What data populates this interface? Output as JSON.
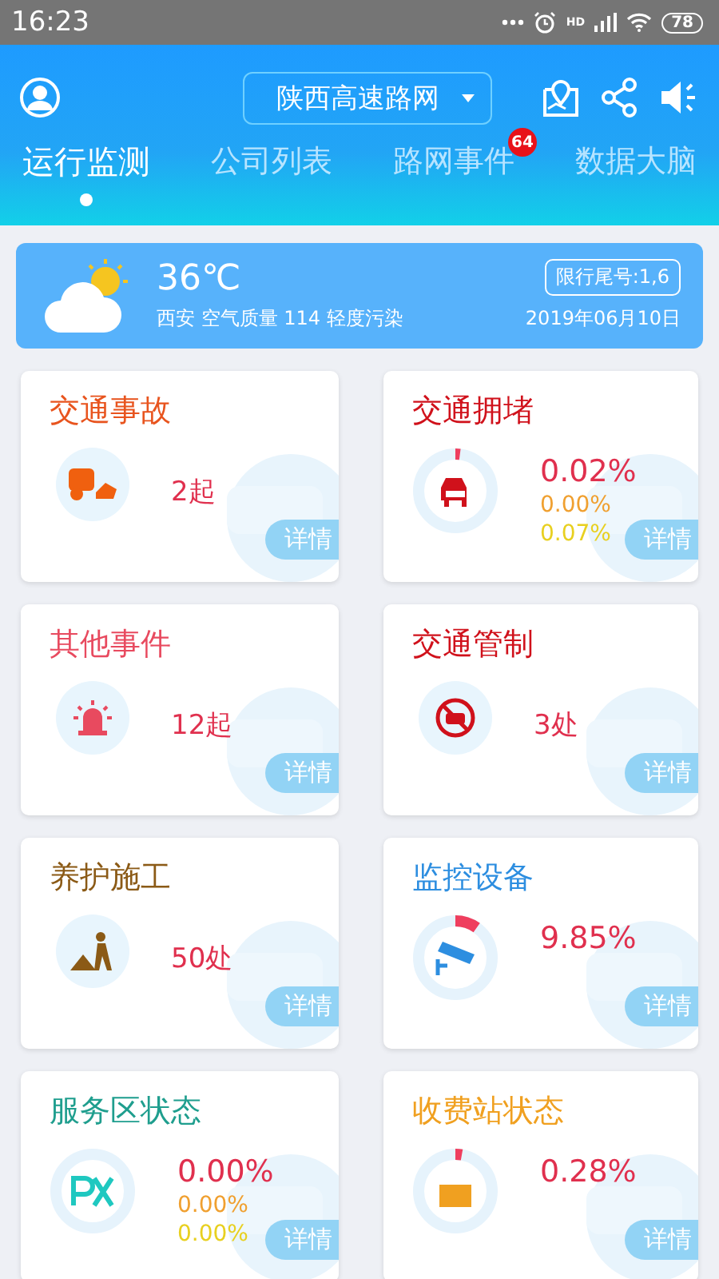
{
  "status_bar": {
    "time": "16:23",
    "network_label": "HD",
    "battery": "78"
  },
  "header": {
    "network_selector": "陕西高速路网"
  },
  "tabs": [
    {
      "label": "运行监测",
      "selected": true
    },
    {
      "label": "公司列表",
      "selected": false
    },
    {
      "label": "路网事件",
      "selected": false,
      "badge": "64"
    },
    {
      "label": "数据大脑",
      "selected": false
    }
  ],
  "weather": {
    "temperature": "36℃",
    "summary": "西安 空气质量 114 轻度污染",
    "restriction": "限行尾号:1,6",
    "date": "2019年06月10日"
  },
  "cards": [
    {
      "kind": "count",
      "title": "交通事故",
      "color": "#e8541e",
      "values": [
        {
          "text": "2起",
          "color": "#e0304e"
        }
      ],
      "detail": "详情"
    },
    {
      "kind": "ring",
      "title": "交通拥堵",
      "color": "#d0111b",
      "level": 0.02,
      "values": [
        {
          "text": "0.02%",
          "color": "#e0304e"
        },
        {
          "text": "0.00%",
          "color": "#f0a030"
        },
        {
          "text": "0.07%",
          "color": "#e8d020"
        }
      ],
      "detail": "详情"
    },
    {
      "kind": "count",
      "title": "其他事件",
      "color": "#e84a5f",
      "values": [
        {
          "text": "12起",
          "color": "#e0304e"
        }
      ],
      "detail": "详情"
    },
    {
      "kind": "count",
      "title": "交通管制",
      "color": "#d0111b",
      "values": [
        {
          "text": "3处",
          "color": "#e0304e"
        }
      ],
      "detail": "详情"
    },
    {
      "kind": "count",
      "title": "养护施工",
      "color": "#8b5a16",
      "values": [
        {
          "text": "50处",
          "color": "#e0304e"
        }
      ],
      "detail": "详情"
    },
    {
      "kind": "ring",
      "title": "监控设备",
      "color": "#2d8ee0",
      "level": 0.0985,
      "values": [
        {
          "text": "9.85%",
          "color": "#e0304e"
        }
      ],
      "detail": "详情"
    },
    {
      "kind": "ring",
      "title": "服务区状态",
      "color": "#1f9e8e",
      "values": [
        {
          "text": "0.00%",
          "color": "#e0304e"
        },
        {
          "text": "0.00%",
          "color": "#f0a030"
        },
        {
          "text": "0.00%",
          "color": "#e8d020"
        }
      ],
      "detail": "详情"
    },
    {
      "kind": "ring",
      "title": "收费站状态",
      "color": "#f0a020",
      "level": 0.028,
      "values": [
        {
          "text": "0.28%",
          "color": "#e0304e"
        }
      ],
      "detail": "详情"
    }
  ]
}
